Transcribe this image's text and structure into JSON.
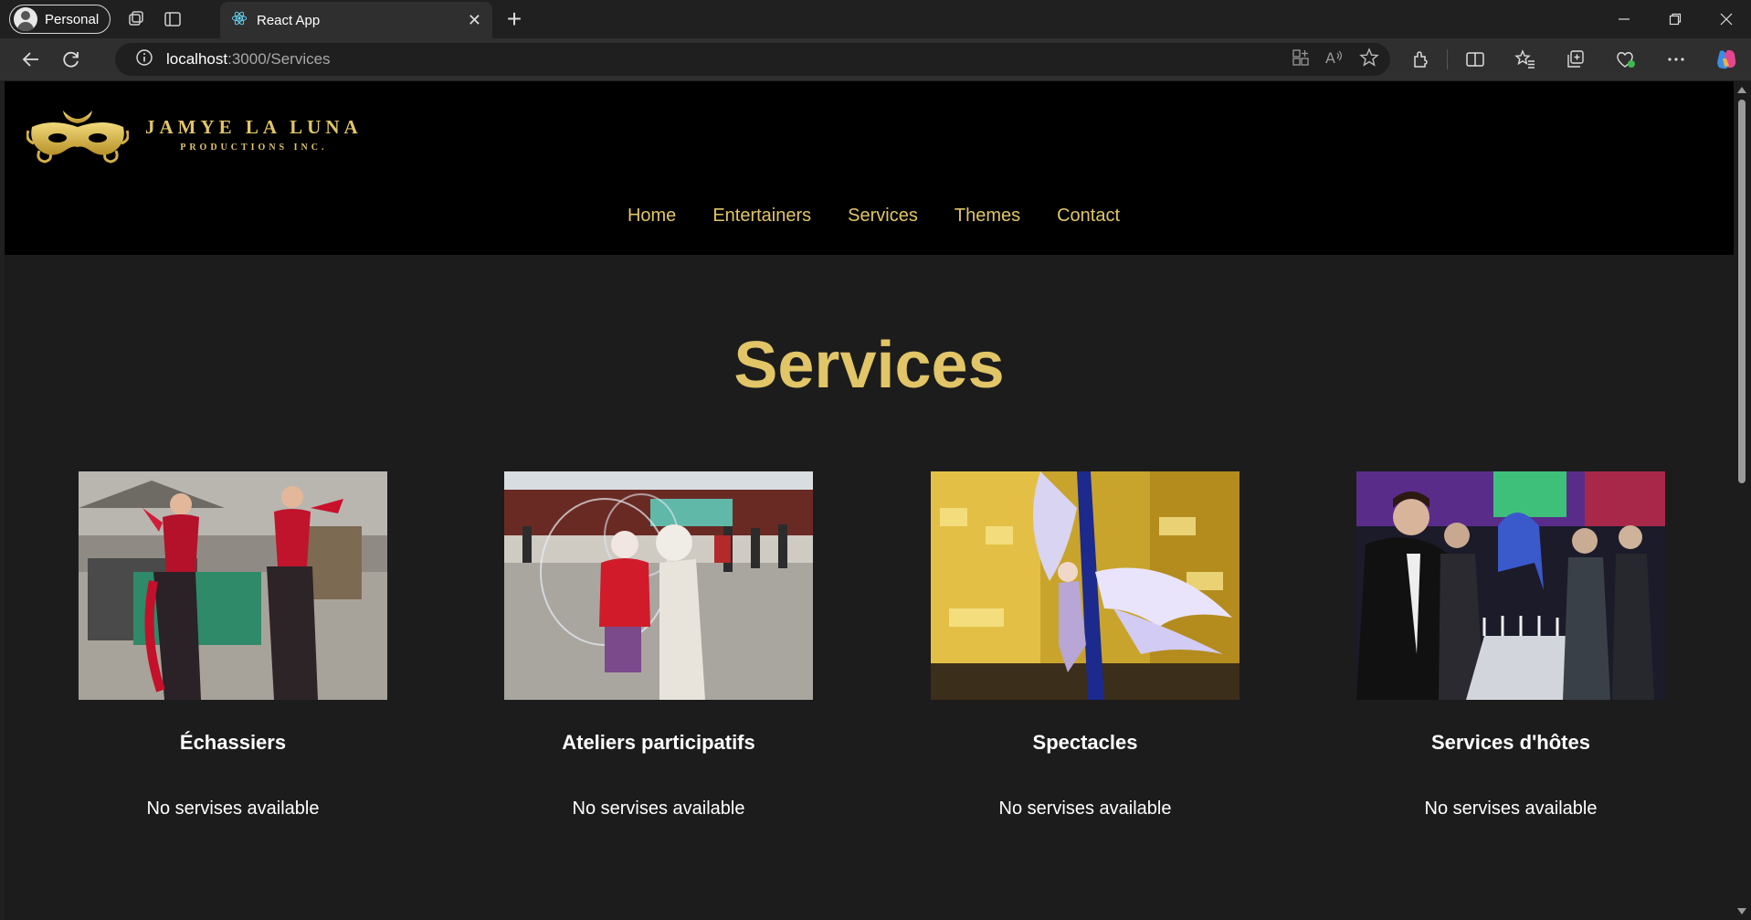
{
  "browser": {
    "profile_label": "Personal",
    "tab_title": "React App",
    "url_host": "localhost",
    "url_path": ":3000/Services"
  },
  "site": {
    "logo_title": "JAMYE LA LUNA",
    "logo_subtitle": "PRODUCTIONS INC.",
    "nav": [
      "Home",
      "Entertainers",
      "Services",
      "Themes",
      "Contact"
    ],
    "page_title": "Services",
    "accent_color": "#e1c567"
  },
  "services": [
    {
      "title": "Échassiers",
      "text": "No servises available"
    },
    {
      "title": "Ateliers participatifs",
      "text": "No servises available"
    },
    {
      "title": "Spectacles",
      "text": "No servises available"
    },
    {
      "title": "Services d'hôtes",
      "text": "No servises available"
    }
  ]
}
